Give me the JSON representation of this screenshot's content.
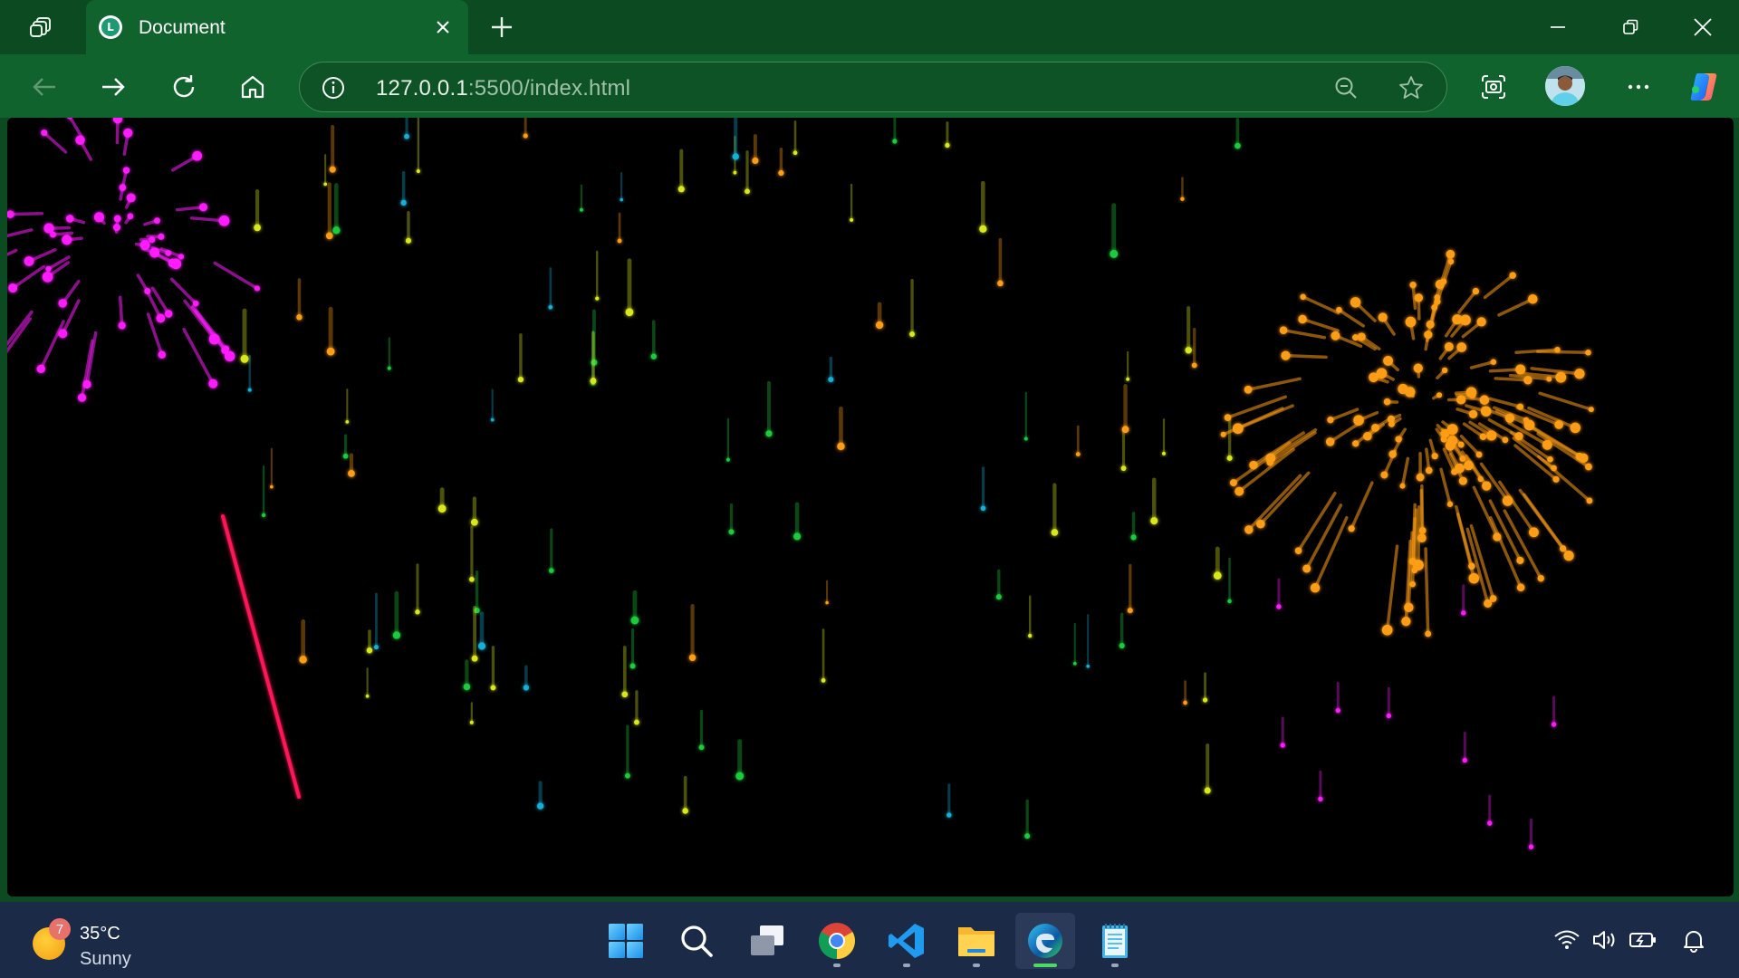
{
  "browser": {
    "tab": {
      "title": "Document",
      "favicon_letter": "L",
      "favicon_icon": "live-server-icon"
    },
    "window_controls": [
      "minimize-icon",
      "restore-icon",
      "close-icon"
    ],
    "toolbar": {
      "buttons": [
        "back-arrow-icon",
        "forward-arrow-icon",
        "refresh-icon",
        "home-icon"
      ],
      "right_buttons": [
        "screenshot-icon",
        "profile-avatar",
        "more-icon",
        "copilot-icon"
      ]
    },
    "address_bar": {
      "url_host": "127.0.0.1",
      "url_rest": ":5500/index.html",
      "icons": [
        "site-info-icon",
        "zoom-out-icon",
        "favorite-star-icon"
      ]
    }
  },
  "page": {
    "content": "fireworks-animation",
    "background": "#000000",
    "colors": {
      "magenta": "#ff1eff",
      "orange": "#ff9d14",
      "red_rocket": "#ff1456",
      "green": "#1ecb3c",
      "yellow": "#d8e81e",
      "cyan": "#16b0d6"
    }
  },
  "taskbar": {
    "weather": {
      "badge": "7",
      "temp": "35°C",
      "condition": "Sunny"
    },
    "apps": [
      {
        "name": "windows-start-icon",
        "active": false
      },
      {
        "name": "search-icon",
        "active": false
      },
      {
        "name": "task-view-icon",
        "active": false
      },
      {
        "name": "chrome-icon",
        "active": false
      },
      {
        "name": "vscode-icon",
        "active": false
      },
      {
        "name": "file-explorer-icon",
        "active": false
      },
      {
        "name": "edge-icon",
        "active": true
      },
      {
        "name": "notepad-icon",
        "active": false
      }
    ],
    "tray": [
      "wifi-icon",
      "volume-icon",
      "battery-icon",
      "notification-bell-icon"
    ]
  }
}
